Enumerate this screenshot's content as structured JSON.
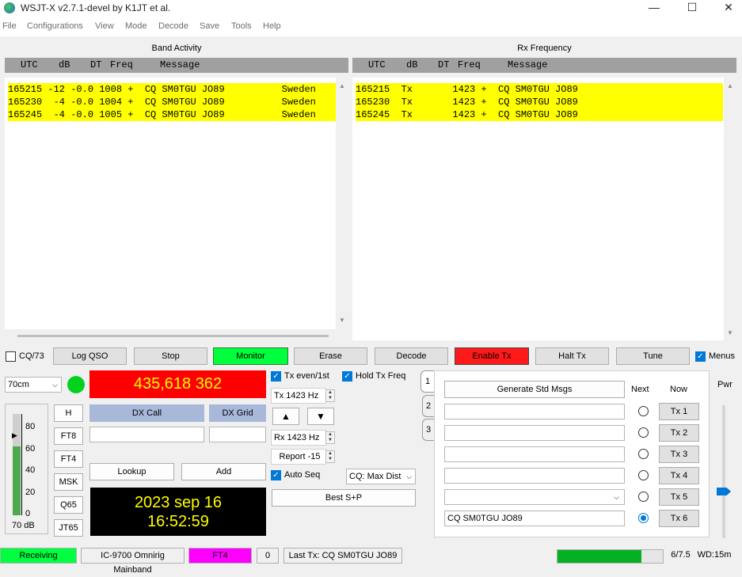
{
  "window": {
    "title": "WSJT-X   v2.7.1-devel   by K1JT et al.",
    "minimize": "—",
    "maximize": "☐",
    "close": "✕"
  },
  "menu": [
    "File",
    "Configurations",
    "View",
    "Mode",
    "Decode",
    "Save",
    "Tools",
    "Help"
  ],
  "band_activity": {
    "title": "Band Activity",
    "headers": [
      "UTC",
      "dB",
      "DT",
      "Freq",
      "Message"
    ],
    "rows": [
      "165215 -12 -0.0 1008 +  CQ SM0TGU JO89          Sweden",
      "165230  -4 -0.0 1004 +  CQ SM0TGU JO89          Sweden",
      "165245  -4 -0.0 1005 +  CQ SM0TGU JO89          Sweden"
    ]
  },
  "rx_frequency": {
    "title": "Rx Frequency",
    "headers": [
      "UTC",
      "dB",
      "DT",
      "Freq",
      "Message"
    ],
    "rows": [
      "165215  Tx       1423 +  CQ SM0TGU JO89",
      "165230  Tx       1423 +  CQ SM0TGU JO89",
      "165245  Tx       1423 +  CQ SM0TGU JO89"
    ]
  },
  "controls": {
    "cq73": "CQ/73",
    "log_qso": "Log QSO",
    "stop": "Stop",
    "monitor": "Monitor",
    "erase": "Erase",
    "decode": "Decode",
    "enable_tx": "Enable Tx",
    "halt_tx": "Halt Tx",
    "tune": "Tune",
    "menus": "Menus"
  },
  "band": {
    "selected": "70cm",
    "frequency": "435,618 362"
  },
  "dx": {
    "call_label": "DX Call",
    "grid_label": "DX Grid",
    "call_value": "",
    "grid_value": "",
    "lookup": "Lookup",
    "add": "Add"
  },
  "clock": {
    "date": "2023 sep 16",
    "time": "16:52:59"
  },
  "mode_buttons": [
    "H",
    "FT8",
    "FT4",
    "MSK",
    "Q65",
    "JT65"
  ],
  "meter": {
    "ticks": [
      "80",
      "60",
      "40",
      "20",
      "0"
    ],
    "level_db": "70 dB",
    "fill_fraction": 0.68
  },
  "tx_options": {
    "tx_even": "Tx even/1st",
    "hold_tx_freq": "Hold Tx Freq",
    "tx_freq": "Tx  1423  Hz",
    "rx_freq": "Rx  1423  Hz",
    "report": "Report  -15",
    "auto_seq": "Auto Seq",
    "cq_select": "CQ: Max Dist",
    "best_sp": "Best S+P",
    "up": "▲",
    "down": "▼"
  },
  "tabs": [
    "1",
    "2",
    "3"
  ],
  "messages": {
    "generate": "Generate Std Msgs",
    "next": "Next",
    "now": "Now",
    "tx_buttons": [
      "Tx 1",
      "Tx 2",
      "Tx 3",
      "Tx 4",
      "Tx 5",
      "Tx 6"
    ],
    "tx6_value": "CQ SM0TGU JO89",
    "selected_next": 6
  },
  "power": {
    "label": "Pwr"
  },
  "statusbar": {
    "receiving": "Receiving",
    "rig": "IC-9700 Omnirig Mainband",
    "mode": "FT4",
    "count": "0",
    "last_tx": "Last Tx: CQ SM0TGU JO89",
    "ratio": "6/7.5",
    "wd": "WD:15m"
  },
  "colors": {
    "yellow": "#ffff00",
    "monitor_green": "#00ff3c",
    "enable_red": "#ff1a1a",
    "freq_red": "#ff0000",
    "ft4_magenta": "#ff00ff",
    "receiving_green": "#00ff40"
  }
}
